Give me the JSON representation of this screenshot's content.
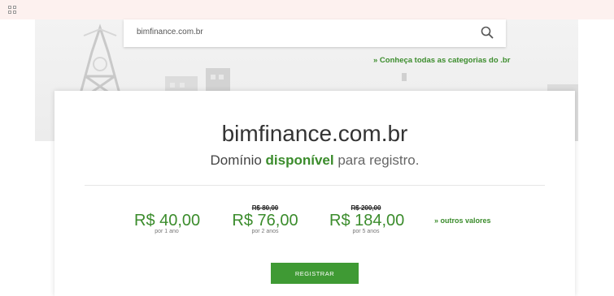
{
  "search": {
    "value": "bimfinance.com.br"
  },
  "categories_link": "» Conheça todas as categorias do .br",
  "card": {
    "domain": "bimfinance.com.br",
    "availability": {
      "prefix": "Domínio ",
      "highlight": "disponível",
      "suffix": " para registro."
    },
    "prices": [
      {
        "old": "",
        "value": "R$ 40,00",
        "period": "por 1 ano"
      },
      {
        "old": "R$ 80,00",
        "value": "R$ 76,00",
        "period": "por 2 anos"
      },
      {
        "old": "R$ 200,00",
        "value": "R$ 184,00",
        "period": "por 5 anos"
      }
    ],
    "other_values_link": "» outros valores",
    "register_button": "REGISTRAR"
  },
  "colors": {
    "accent_green": "#3b8c2c",
    "button_green": "#3f9a34",
    "topbar_bg": "#fdf1ef"
  }
}
